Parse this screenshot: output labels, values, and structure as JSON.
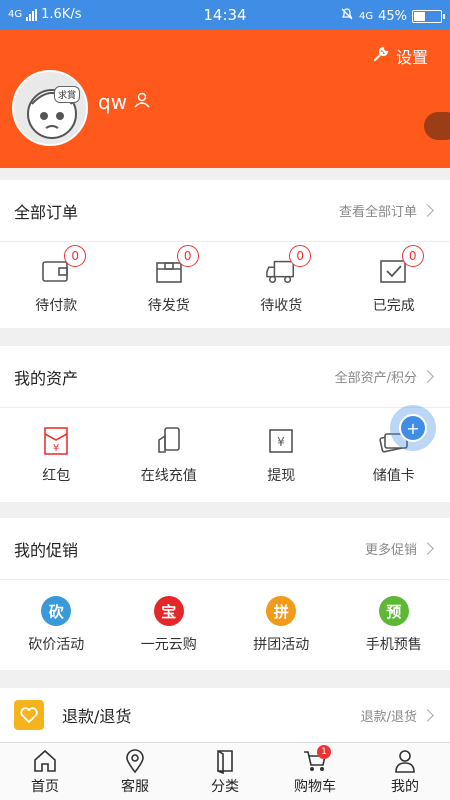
{
  "status_bar": {
    "network": "4G",
    "speed": "1.6K/s",
    "time": "14:34",
    "net_right": "4G",
    "battery": "45%",
    "battery_level": 0.45
  },
  "header": {
    "settings_label": "设置",
    "username": "qw",
    "avatar_badge": "求賞"
  },
  "orders": {
    "title": "全部订单",
    "link": "查看全部订单",
    "items": [
      {
        "label": "待付款",
        "count": "0",
        "icon": "wallet-icon"
      },
      {
        "label": "待发货",
        "count": "0",
        "icon": "box-icon"
      },
      {
        "label": "待收货",
        "count": "0",
        "icon": "truck-icon"
      },
      {
        "label": "已完成",
        "count": "0",
        "icon": "check-box-icon"
      }
    ]
  },
  "assets": {
    "title": "我的资产",
    "link": "全部资产/积分",
    "items": [
      {
        "label": "红包",
        "glyph": "¥",
        "icon": "red-packet-icon"
      },
      {
        "label": "在线充值",
        "glyph": "",
        "icon": "recharge-icon"
      },
      {
        "label": "提现",
        "glyph": "¥",
        "icon": "withdraw-icon"
      },
      {
        "label": "储值卡",
        "glyph": "",
        "icon": "card-icon"
      }
    ]
  },
  "promos": {
    "title": "我的促销",
    "link": "更多促销",
    "items": [
      {
        "label": "砍价活动",
        "glyph": "砍",
        "color": "#3a9ad9"
      },
      {
        "label": "一元云购",
        "glyph": "宝",
        "color": "#e5262a"
      },
      {
        "label": "拼团活动",
        "glyph": "拼",
        "color": "#f29a1a"
      },
      {
        "label": "手机预售",
        "glyph": "预",
        "color": "#5cb836"
      }
    ]
  },
  "refund": {
    "title": "退款/退货",
    "link": "退款/退货"
  },
  "fab": {
    "glyph": "+"
  },
  "tabbar": {
    "items": [
      {
        "label": "首页",
        "icon": "home-icon"
      },
      {
        "label": "客服",
        "icon": "location-pin-icon"
      },
      {
        "label": "分类",
        "icon": "book-icon"
      },
      {
        "label": "购物车",
        "icon": "cart-icon",
        "badge": "1"
      },
      {
        "label": "我的",
        "icon": "person-icon"
      }
    ]
  },
  "colors": {
    "status_bar": "#3f8de4",
    "header": "#ff5a1c",
    "badge_red": "#e33"
  }
}
